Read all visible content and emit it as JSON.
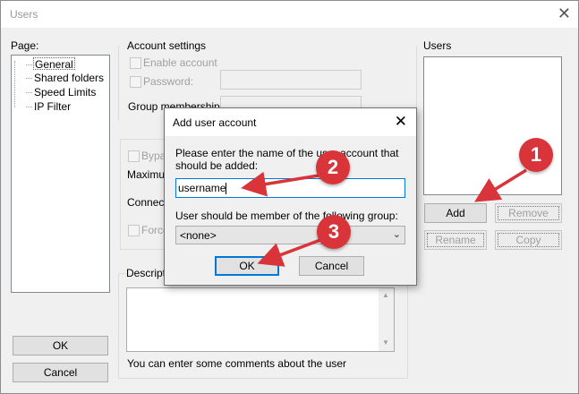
{
  "window": {
    "title": "Users",
    "close_icon": "close-icon"
  },
  "page_panel": {
    "label": "Page:",
    "items": [
      "General",
      "Shared folders",
      "Speed Limits",
      "IP Filter"
    ]
  },
  "account_settings": {
    "title": "Account settings",
    "enable_account": "Enable account",
    "password": "Password:",
    "group_membership": "Group membership:"
  },
  "partial_labels": {
    "bypass": "Bypas",
    "maximum": "Maximum",
    "connection": "Connectio",
    "force": "Force",
    "description": "Descriptio"
  },
  "comments_hint": "You can enter some comments about the user",
  "users_panel": {
    "label": "Users",
    "add": "Add",
    "remove": "Remove",
    "rename": "Rename",
    "copy": "Copy"
  },
  "main_buttons": {
    "ok": "OK",
    "cancel": "Cancel"
  },
  "dialog": {
    "title": "Add user account",
    "prompt": "Please enter the name of the user account that should be added:",
    "input_value": "username",
    "group_label": "User should be member of the following group:",
    "group_value": "<none>",
    "ok": "OK",
    "cancel": "Cancel"
  },
  "annotations": {
    "marker1": "1",
    "marker2": "2",
    "marker3": "3",
    "color": "#d9343a"
  }
}
